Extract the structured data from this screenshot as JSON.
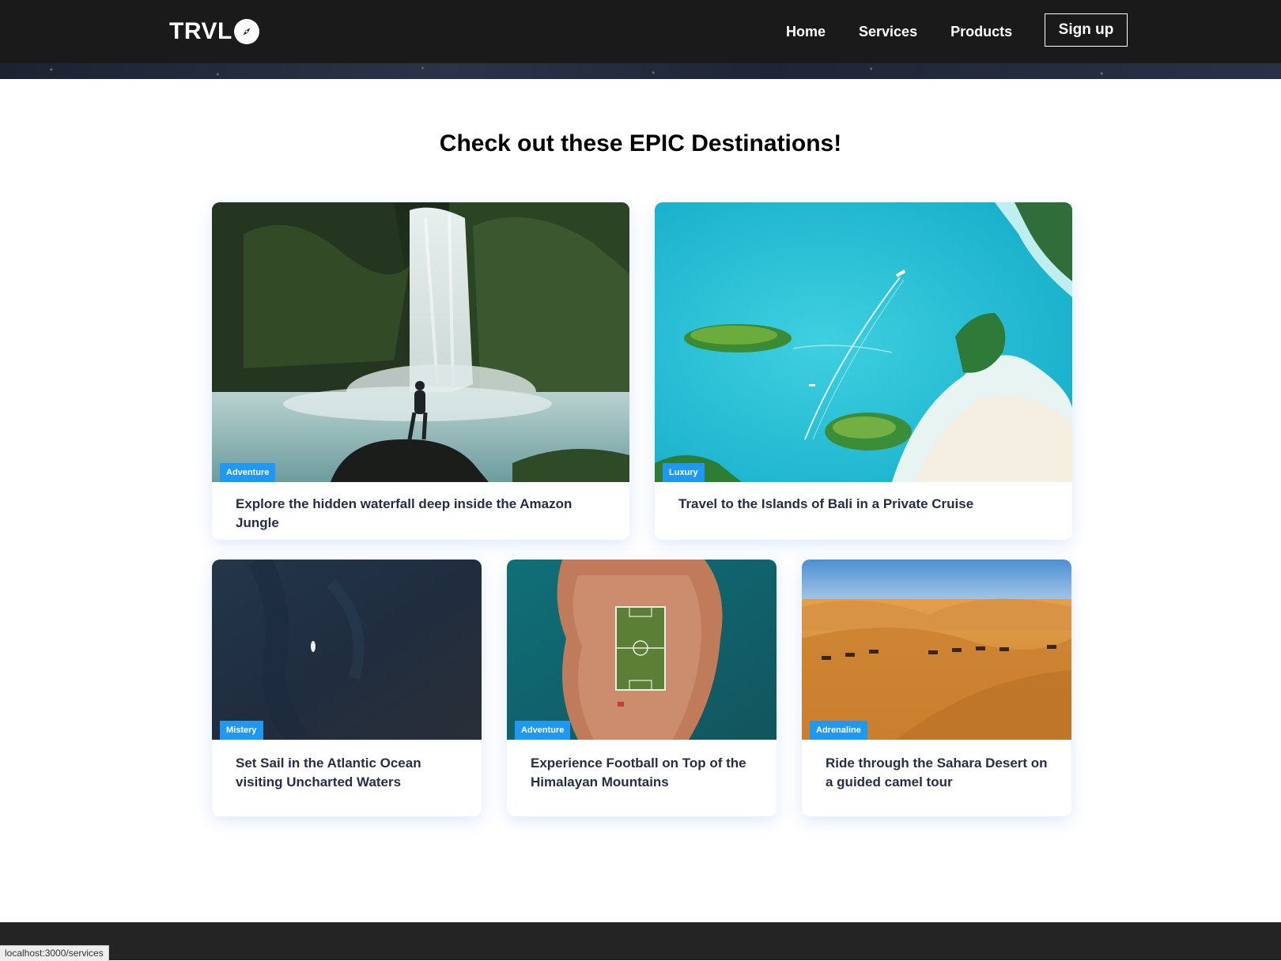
{
  "navbar": {
    "logo_text": "TRVL",
    "logo_icon": "compass-icon",
    "links": [
      {
        "label": "Home"
      },
      {
        "label": "Services"
      },
      {
        "label": "Products"
      }
    ],
    "signup_label": "Sign up"
  },
  "main": {
    "title": "Check out these EPIC Destinations!",
    "cards": [
      {
        "label": "Adventure",
        "text": "Explore the hidden waterfall deep inside the Amazon Jungle",
        "image": "waterfall-image"
      },
      {
        "label": "Luxury",
        "text": "Travel to the Islands of Bali in a Private Cruise",
        "image": "islands-image"
      },
      {
        "label": "Mistery",
        "text": "Set Sail in the Atlantic Ocean visiting Uncharted Waters",
        "image": "ocean-image"
      },
      {
        "label": "Adventure",
        "text": "Experience Football on Top of the Himalayan Mountains",
        "image": "football-island-image"
      },
      {
        "label": "Adrenaline",
        "text": "Ride through the Sahara Desert on a guided camel tour",
        "image": "desert-image"
      }
    ]
  },
  "status_bar": {
    "url": "localhost:3000/services"
  },
  "colors": {
    "navbar_bg": "#1a1a1a",
    "label_bg": "#1f98f4",
    "card_text": "#252e48",
    "footer_bg": "#242424"
  }
}
